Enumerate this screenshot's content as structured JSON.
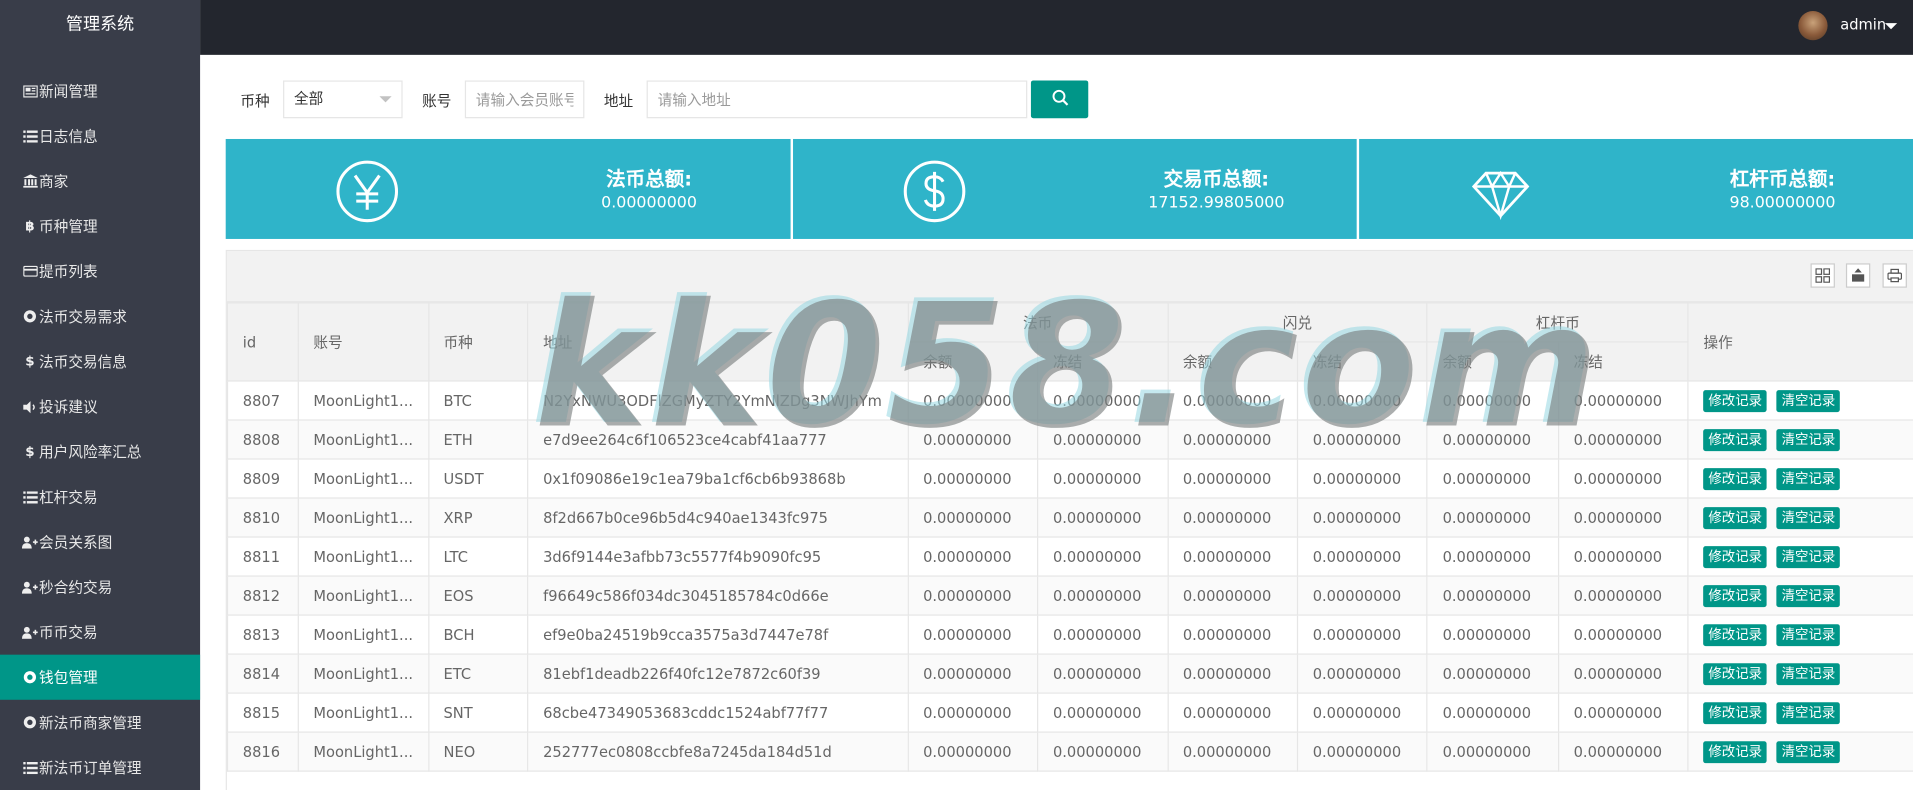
{
  "app": {
    "brand": "管理系统"
  },
  "header": {
    "user": "admin"
  },
  "sidebar": {
    "items": [
      {
        "label": "新闻管理",
        "icon": "newspaper-icon"
      },
      {
        "label": "日志信息",
        "icon": "list-icon"
      },
      {
        "label": "商家",
        "icon": "bank-icon"
      },
      {
        "label": "币种管理",
        "icon": "bitcoin-icon"
      },
      {
        "label": "提币列表",
        "icon": "credit-card-icon"
      },
      {
        "label": "法币交易需求",
        "icon": "circle-icon"
      },
      {
        "label": "法币交易信息",
        "icon": "dollar-icon"
      },
      {
        "label": "投诉建议",
        "icon": "volume-icon"
      },
      {
        "label": "用户风险率汇总",
        "icon": "dollar-icon"
      },
      {
        "label": "杠杆交易",
        "icon": "list-icon"
      },
      {
        "label": "会员关系图",
        "icon": "user-plus-icon"
      },
      {
        "label": "秒合约交易",
        "icon": "user-plus-icon"
      },
      {
        "label": "币币交易",
        "icon": "user-plus-icon"
      },
      {
        "label": "钱包管理",
        "icon": "circle-icon",
        "active": true
      },
      {
        "label": "新法币商家管理",
        "icon": "circle-icon"
      },
      {
        "label": "新法币订单管理",
        "icon": "list-icon"
      }
    ]
  },
  "filters": {
    "currency_label": "币种",
    "currency_value": "全部",
    "account_label": "账号",
    "account_placeholder": "请输入会员账号",
    "address_label": "地址",
    "address_placeholder": "请输入地址"
  },
  "stats": [
    {
      "label": "法币总额:",
      "value": "0.00000000",
      "icon": "yen-icon"
    },
    {
      "label": "交易币总额:",
      "value": "17152.99805000",
      "icon": "dollar-icon"
    },
    {
      "label": "杠杆币总额:",
      "value": "98.00000000",
      "icon": "diamond-icon"
    }
  ],
  "table": {
    "headers": {
      "id": "id",
      "account": "账号",
      "currency": "币种",
      "address": "地址",
      "fiat": "法币",
      "flash": "闪兑",
      "leverage": "杠杆币",
      "balance": "余额",
      "frozen": "冻结",
      "actions": "操作"
    },
    "action_labels": {
      "edit": "修改记录",
      "clear": "清空记录"
    },
    "rows": [
      {
        "id": "8807",
        "account": "MoonLight1...",
        "currency": "BTC",
        "address": "N2YxNWU3ODFlZGMyZTY2YmNlZDg3NWJhYm",
        "v": [
          "0.00000000",
          "0.00000000",
          "0.00000000",
          "0.00000000",
          "0.00000000",
          "0.00000000"
        ]
      },
      {
        "id": "8808",
        "account": "MoonLight1...",
        "currency": "ETH",
        "address": "e7d9ee264c6f106523ce4cabf41aa777",
        "v": [
          "0.00000000",
          "0.00000000",
          "0.00000000",
          "0.00000000",
          "0.00000000",
          "0.00000000"
        ]
      },
      {
        "id": "8809",
        "account": "MoonLight1...",
        "currency": "USDT",
        "address": "0x1f09086e19c1ea79ba1cf6cb6b93868b",
        "v": [
          "0.00000000",
          "0.00000000",
          "0.00000000",
          "0.00000000",
          "0.00000000",
          "0.00000000"
        ]
      },
      {
        "id": "8810",
        "account": "MoonLight1...",
        "currency": "XRP",
        "address": "8f2d667b0ce96b5d4c940ae1343fc975",
        "v": [
          "0.00000000",
          "0.00000000",
          "0.00000000",
          "0.00000000",
          "0.00000000",
          "0.00000000"
        ]
      },
      {
        "id": "8811",
        "account": "MoonLight1...",
        "currency": "LTC",
        "address": "3d6f9144e3afbb73c5577f4b9090fc95",
        "v": [
          "0.00000000",
          "0.00000000",
          "0.00000000",
          "0.00000000",
          "0.00000000",
          "0.00000000"
        ]
      },
      {
        "id": "8812",
        "account": "MoonLight1...",
        "currency": "EOS",
        "address": "f96649c586f034dc3045185784c0d66e",
        "v": [
          "0.00000000",
          "0.00000000",
          "0.00000000",
          "0.00000000",
          "0.00000000",
          "0.00000000"
        ]
      },
      {
        "id": "8813",
        "account": "MoonLight1...",
        "currency": "BCH",
        "address": "ef9e0ba24519b9cca3575a3d7447e78f",
        "v": [
          "0.00000000",
          "0.00000000",
          "0.00000000",
          "0.00000000",
          "0.00000000",
          "0.00000000"
        ]
      },
      {
        "id": "8814",
        "account": "MoonLight1...",
        "currency": "ETC",
        "address": "81ebf1deadb226f40fc12e7872c60f39",
        "v": [
          "0.00000000",
          "0.00000000",
          "0.00000000",
          "0.00000000",
          "0.00000000",
          "0.00000000"
        ]
      },
      {
        "id": "8815",
        "account": "MoonLight1...",
        "currency": "SNT",
        "address": "68cbe47349053683cddc1524abf77f77",
        "v": [
          "0.00000000",
          "0.00000000",
          "0.00000000",
          "0.00000000",
          "0.00000000",
          "0.00000000"
        ]
      },
      {
        "id": "8816",
        "account": "MoonLight1...",
        "currency": "NEO",
        "address": "252777ec0808ccbfe8a7245da184d51d",
        "v": [
          "0.00000000",
          "0.00000000",
          "0.00000000",
          "0.00000000",
          "0.00000000",
          "0.00000000"
        ]
      }
    ]
  },
  "watermark": "kk058.com",
  "colors": {
    "sidebar": "#393d49",
    "header": "#23262e",
    "accent": "#009688",
    "card": "#2fb4c9"
  }
}
